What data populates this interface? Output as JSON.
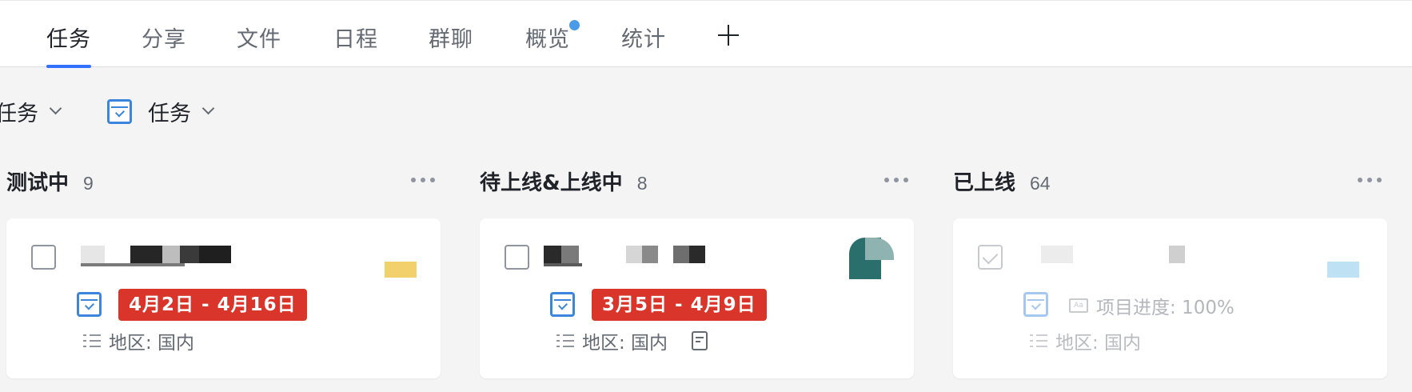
{
  "tabs": [
    {
      "label": "任务",
      "active": true
    },
    {
      "label": "分享"
    },
    {
      "label": "文件"
    },
    {
      "label": "日程"
    },
    {
      "label": "群聊"
    },
    {
      "label": "概览",
      "has_notification": true
    },
    {
      "label": "统计"
    }
  ],
  "add_tab_icon": "plus-icon",
  "filters": [
    {
      "label": "任务",
      "icon": "chevron-down-icon"
    },
    {
      "label": "任务",
      "icon": "task-icon"
    }
  ],
  "columns": [
    {
      "title": "测试中",
      "count": "9",
      "card": {
        "completed": false,
        "date_range": "4月2日 - 4月16日",
        "region": "地区: 国内",
        "tag_color": "#f2d06b"
      }
    },
    {
      "title": "待上线&上线中",
      "count": "8",
      "card": {
        "completed": false,
        "date_range": "3月5日 - 4月9日",
        "region": "地区: 国内",
        "has_doc": true
      }
    },
    {
      "title": "已上线",
      "count": "64",
      "card": {
        "completed": true,
        "progress": "项目进度: 100%",
        "region": "地区: 国内",
        "tag_color": "#bfe1f4"
      }
    }
  ],
  "colors": {
    "accent": "#3370ff",
    "date_badge": "#d9352b",
    "task_icon": "#3b86dc",
    "notify_dot": "#4a9be8"
  }
}
